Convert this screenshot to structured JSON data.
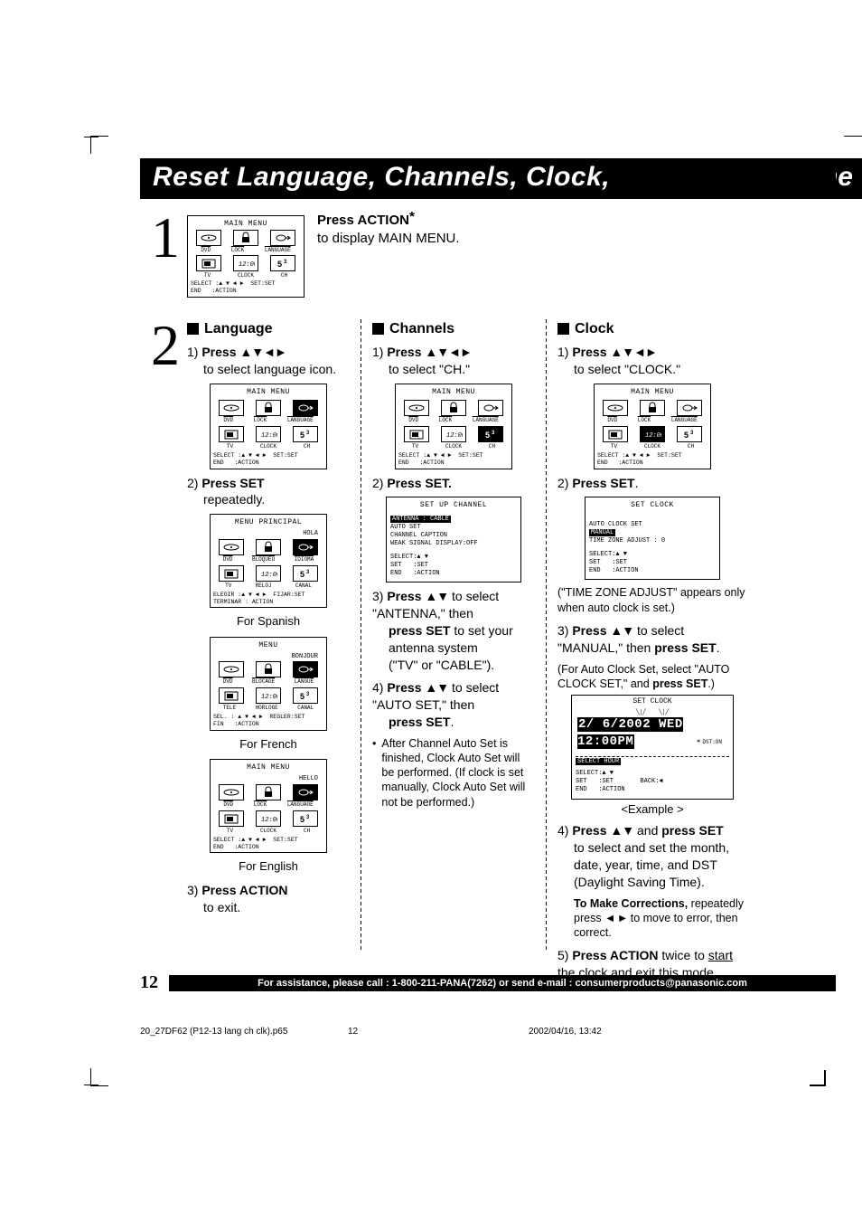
{
  "title_left": "Reset Language, Channels, Clock,",
  "title_right": "Time",
  "step1": {
    "num": "1",
    "action_label": "Press ACTION",
    "asterisk_marker": "*",
    "body": "to display MAIN MENU."
  },
  "osd": {
    "main_menu_title": "MAIN MENU",
    "labels_en": [
      "DVD",
      "LOCK",
      "LANGUAGE",
      "TV",
      "CLOCK",
      "CH"
    ],
    "foot_en_select": "SELECT :▲ ▼ ◄ ►  SET:SET\nEND   :ACTION",
    "menu_principal_title": "MENU PRINCIPAL",
    "hello_es": "HOLA",
    "labels_es": [
      "DVD",
      "BLOQUEO",
      "IDIOMA",
      "TV",
      "RELOJ",
      "CANAL"
    ],
    "foot_es": "ELEGIR :▲ ▼ ◄ ►  FIJAR:SET\nTERMINAR : ACTION",
    "menu_fr_title": "MENU",
    "hello_fr": "BONJOUR",
    "labels_fr": [
      "DVD",
      "BLOCAGE",
      "LANGUE",
      "TELE",
      "HORLOGE",
      "CANAL"
    ],
    "foot_fr": "SEL. : ▲ ▼ ◄ ►  REGLER:SET\nFIN   :ACTION",
    "hello_en": "HELLO",
    "setup_channel_title": "SET UP CHANNEL",
    "ch_line1_hl": "ANTENNA   : CABLE",
    "ch_line2": "AUTO SET",
    "ch_line3": "CHANNEL CAPTION",
    "ch_line4": "WEAK SIGNAL DISPLAY:OFF",
    "ch_foot": "SELECT:▲ ▼\nSET   :SET\nEND   :ACTION",
    "set_clock_title": "SET CLOCK",
    "clk_line1": "AUTO CLOCK SET",
    "clk_line2_hl": "MANUAL",
    "clk_line3": "TIME ZONE ADJUST : 0",
    "clk_foot": "SELECT:▲ ▼\nSET   :SET\nEND   :ACTION",
    "clk2_date": "2/ 6/2002 WED 12:00PM",
    "clk2_sun": "DST:ON",
    "clk2_sel_hl": "SELECT HOUR",
    "clk2_foot": "SELECT:▲ ▼\nSET   :SET       BACK:◄\nEND   :ACTION"
  },
  "step2_num": "2",
  "language": {
    "header": "Language",
    "item1_a": "Press ",
    "item1_b": " to select language icon.",
    "item2_a": "Press SET",
    "item2_b": " repeatedly.",
    "cap_es": "For Spanish",
    "cap_fr": "For French",
    "cap_en": "For English",
    "item3_a": "Press ACTION",
    "item3_b": " to exit."
  },
  "channels": {
    "header": "Channels",
    "item1_a": "Press ",
    "item1_b": " to select \"CH.\"",
    "item2": "Press SET.",
    "item3_a": "Press ",
    "item3_b": " to select \"ANTENNA,\" then ",
    "item3_c": "press SET",
    "item3_d": " to set your antenna system",
    "item3_e": "(\"TV\" or \"CABLE\").",
    "item4_a": "Press ",
    "item4_b": " to select \"AUTO SET,\" then ",
    "item4_c": "press SET",
    "item4_d": ".",
    "bullet": "After Channel Auto Set is finished, Clock Auto Set will be performed. (If clock is set manually, Clock Auto Set will not be performed.)"
  },
  "clock": {
    "header": "Clock",
    "item1_a": "Press ",
    "item1_b": " to select \"CLOCK.\"",
    "item2": "Press SET",
    "item2_dot": ".",
    "tz_note": "(\"TIME ZONE ADJUST\" appears only when auto clock is set.)",
    "item3_a": "Press ",
    "item3_b": " to select \"MANUAL,\" then ",
    "item3_c": "press SET",
    "item3_d": ".",
    "auto_note_a": "(For Auto Clock Set, select \"AUTO CLOCK SET,\" and ",
    "auto_note_b": "press SET",
    "auto_note_c": ".)",
    "example_label": "<Example >",
    "item4_a": "Press ",
    "item4_b": " and ",
    "item4_c": "press SET",
    "item4_d": " to select and set the month, date, year, time, and DST (Daylight Saving Time).",
    "corr_head": "To Make Corrections,",
    "corr_body_a": " repeatedly press ",
    "corr_body_b": " to move to error, then correct.",
    "item5_a": "Press ACTION",
    "item5_b": " twice to ",
    "item5_c": "start the clock",
    "item5_d": " and exit this mode."
  },
  "page_number": "12",
  "assist_line": "For assistance, please call : 1-800-211-PANA(7262) or send e-mail : consumerproducts@panasonic.com",
  "imprint_file": "20_27DF62 (P12-13 lang ch clk).p65",
  "imprint_pg": "12",
  "imprint_date": "2002/04/16, 13:42"
}
